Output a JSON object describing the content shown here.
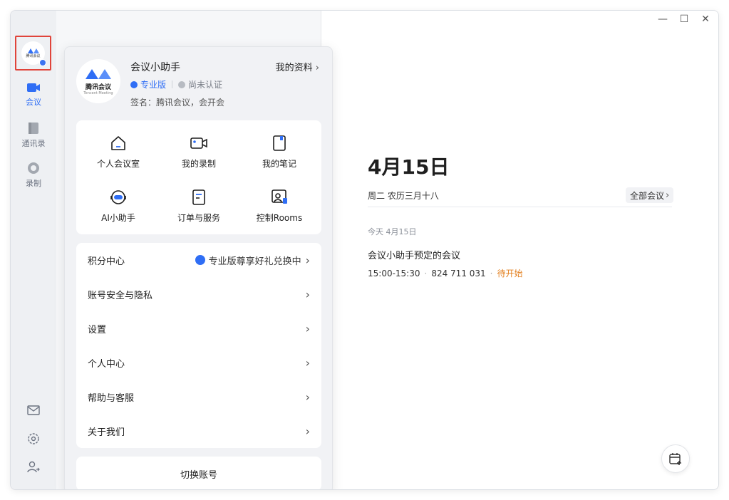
{
  "window_controls": {
    "minimize": "—",
    "maximize": "☐",
    "close": "✕"
  },
  "sidebar": {
    "avatar_text": "腾讯会议",
    "nav": [
      {
        "label": "会议",
        "icon": "video-icon",
        "active": true
      },
      {
        "label": "通讯录",
        "icon": "contacts-icon",
        "active": false
      },
      {
        "label": "录制",
        "icon": "record-icon",
        "active": false
      }
    ],
    "bottom_icons": [
      "mail-icon",
      "settings-icon",
      "user-switch-icon"
    ]
  },
  "profile": {
    "logo_brand": "腾讯会议",
    "logo_brand_en": "Tencent Meeting",
    "name": "会议小助手",
    "my_info": "我的资料",
    "edition": "专业版",
    "verify": "尚未认证",
    "signature": "签名：腾讯会议，会开会"
  },
  "grid": [
    {
      "label": "个人会议室",
      "icon": "home-icon"
    },
    {
      "label": "我的录制",
      "icon": "video-record-icon"
    },
    {
      "label": "我的笔记",
      "icon": "note-icon"
    },
    {
      "label": "AI小助手",
      "icon": "ai-assistant-icon"
    },
    {
      "label": "订单与服务",
      "icon": "order-icon"
    },
    {
      "label": "控制Rooms",
      "icon": "rooms-icon"
    }
  ],
  "menu": [
    {
      "label": "积分中心",
      "extra": "专业版尊享好礼兑换中"
    },
    {
      "label": "账号安全与隐私",
      "extra": ""
    },
    {
      "label": "设置",
      "extra": ""
    },
    {
      "label": "个人中心",
      "extra": ""
    },
    {
      "label": "帮助与客服",
      "extra": ""
    },
    {
      "label": "关于我们",
      "extra": ""
    }
  ],
  "switch_account": "切换账号",
  "main": {
    "date": "4月15日",
    "date_sub": "周二 农历三月十八",
    "all_meetings": "全部会议",
    "day_label": "今天 4月15日",
    "meeting": {
      "title": "会议小助手预定的会议",
      "time": "15:00-15:30",
      "id": "824 711 031",
      "status": "待开始"
    }
  },
  "colors": {
    "accent": "#2f6ef5",
    "status_pending": "#e37f1e",
    "highlight_border": "#e0443a"
  }
}
